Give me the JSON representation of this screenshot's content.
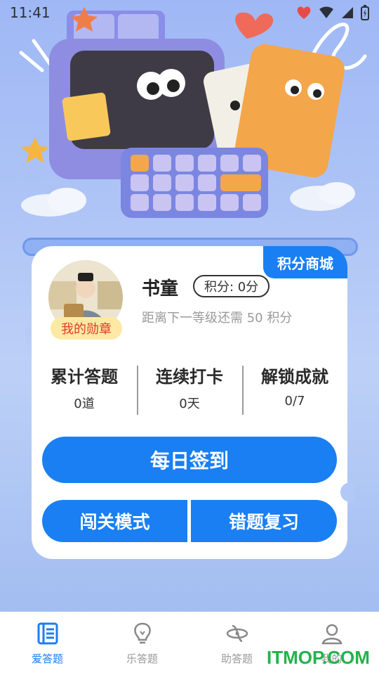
{
  "status_bar": {
    "time": "11:41"
  },
  "hero": {
    "description_icon": "clay-computer-illustration"
  },
  "card": {
    "mall_tag": "积分商城",
    "medal_badge": "我的勋章",
    "username": "书童",
    "points_label": "积分: 0分",
    "level_hint": "距离下一等级还需 50 积分",
    "stats": [
      {
        "label": "累计答题",
        "value": "0道"
      },
      {
        "label": "连续打卡",
        "value": "0天"
      },
      {
        "label": "解锁成就",
        "value": "0/7"
      }
    ],
    "checkin_button": "每日签到",
    "level_mode_button": "闯关模式",
    "review_button": "错题复习"
  },
  "nav": {
    "items": [
      {
        "label": "爱答题",
        "icon": "book-icon",
        "active": true
      },
      {
        "label": "乐答题",
        "icon": "lightbulb-icon",
        "active": false
      },
      {
        "label": "助答题",
        "icon": "orbit-icon",
        "active": false
      },
      {
        "label": "我的",
        "icon": "user-icon",
        "active": false
      }
    ]
  },
  "watermark": "ITMOP.COM",
  "colors": {
    "accent": "#1a7ff2",
    "badge_bg": "#fde9a3",
    "badge_text": "#e03c2e"
  }
}
